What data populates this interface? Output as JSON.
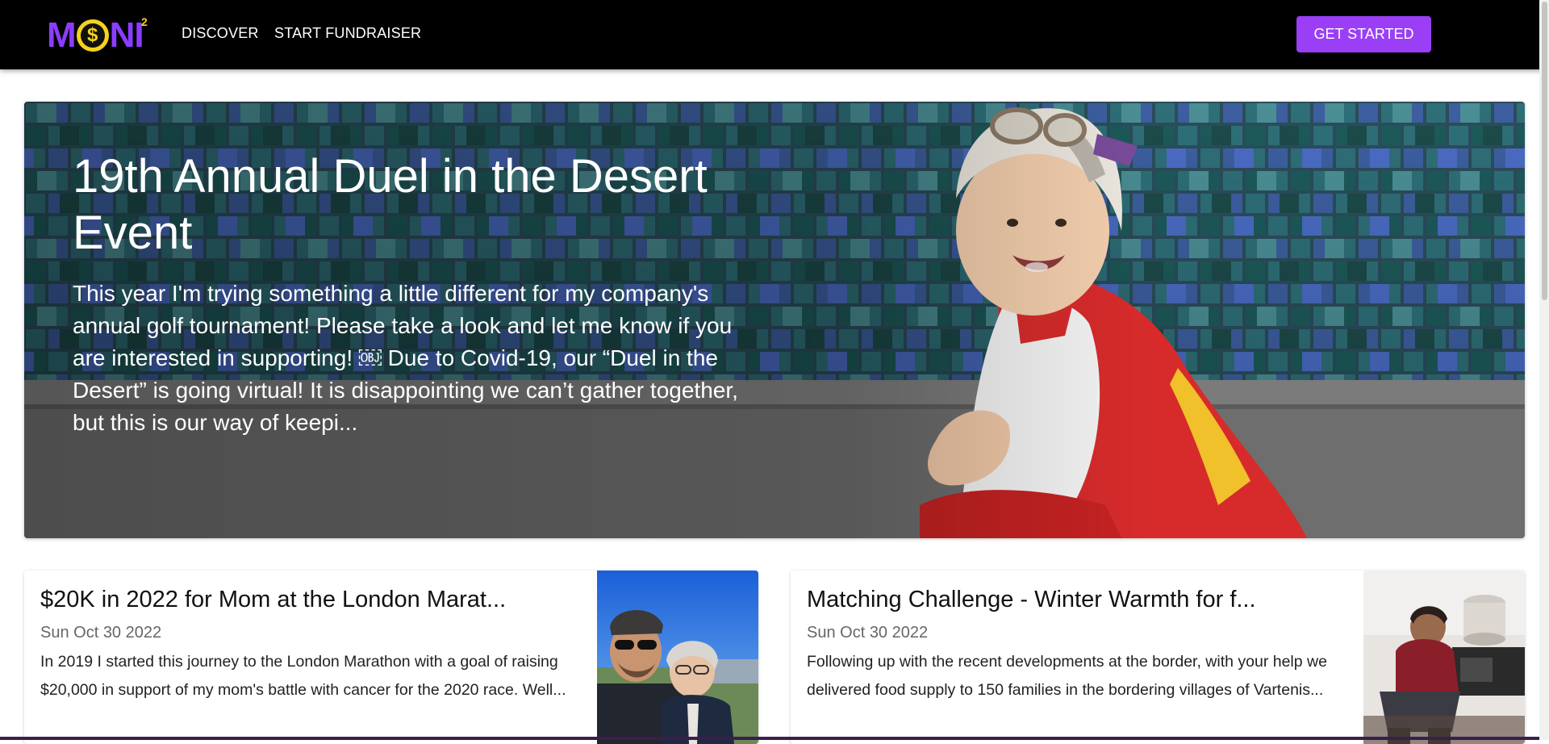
{
  "nav": {
    "logo_text_left": "M",
    "logo_coin": "$",
    "logo_text_right": "NI",
    "logo_sup": "2",
    "links": [
      "DISCOVER",
      "START FUNDRAISER"
    ],
    "cta_label": "GET STARTED"
  },
  "colors": {
    "nav_bg": "#000000",
    "accent": "#9a3ff6",
    "logo_coin": "#f4d21f"
  },
  "hero": {
    "title": "19th Annual Duel in the Desert Event",
    "description": "This year I'm trying something a little different for my company's annual golf tournament! Please take a look and let me know if you are interested in supporting! ￼ Due to Covid-19, our “Duel in the Desert” is going virtual! It is disappointing we can’t gather together, but this is our way of keepi..."
  },
  "cards": [
    {
      "title": "$20K in 2022 for Mom at the London Marat...",
      "date": "Sun Oct 30 2022",
      "excerpt": "In 2019 I started this journey to the London Marathon with a goal of raising $20,000 in support of my mom's battle with cancer for the 2020 race. Well..."
    },
    {
      "title": "Matching Challenge - Winter Warmth for f...",
      "date": "Sun Oct 30 2022",
      "excerpt": "Following up with the recent developments at the border, with your help we delivered food supply to 150 families in the bordering villages of Vartenis..."
    }
  ]
}
